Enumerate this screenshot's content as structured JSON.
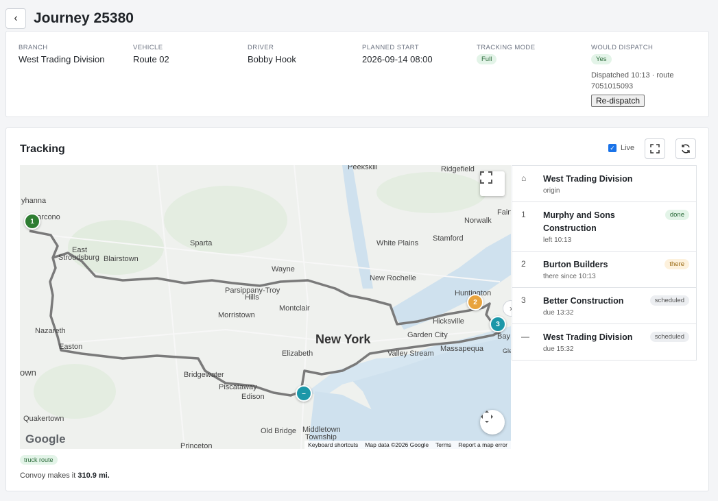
{
  "header": {
    "title": "Journey 25380"
  },
  "info": {
    "branch": {
      "label": "BRANCH",
      "value": "West Trading Division"
    },
    "vehicle": {
      "label": "VEHICLE",
      "value": "Route 02"
    },
    "driver": {
      "label": "DRIVER",
      "value": "Bobby Hook"
    },
    "planned_start": {
      "label": "PLANNED START",
      "value": "2026-09-14 08:00"
    },
    "tracking_mode": {
      "label": "TRACKING MODE",
      "value": "Full"
    },
    "would_dispatch": {
      "label": "WOULD DISPATCH",
      "value": "Yes",
      "note": "Dispatched 10:13 · route 7051015093",
      "button": "Re-dispatch"
    }
  },
  "tracking": {
    "title": "Tracking",
    "live_label": "Live",
    "live_checked": true,
    "map": {
      "places": [
        "Peekskill",
        "Ridgefield",
        "Fairf",
        "yhanna",
        "Marcono",
        "Norwalk",
        "Sparta",
        "East",
        "Stroudsburg",
        "Blairstown",
        "White Plains",
        "Stamford",
        "Wayne",
        "New Rochelle",
        "Parsippany-Troy",
        "Hills",
        "Huntington",
        "Montclair",
        "Morristown",
        "Hicksville",
        "New York",
        "Garden City",
        "Nazareth",
        "Bay",
        "Easton",
        "Elizabeth",
        "Valley Stream",
        "Massapequa",
        "own",
        "Bridgewater",
        "Piscataway",
        "Edison",
        "Quakertown",
        "Old Bridge",
        "Middletown",
        "Township",
        "Princeton",
        "Gle"
      ],
      "markers": [
        {
          "label": "1",
          "color": "#2e7d32"
        },
        {
          "label": "2",
          "color": "#e8a33d"
        },
        {
          "label": "3",
          "color": "#1c97a8"
        },
        {
          "label": "–",
          "color": "#1c97a8"
        }
      ],
      "google_logo": "Google",
      "attribution": [
        "Keyboard shortcuts",
        "Map data ©2026 Google",
        "Terms",
        "Report a map error"
      ]
    },
    "stops": [
      {
        "index": "⌂",
        "name": "West Trading Division",
        "sub": "origin",
        "badge": "",
        "badge_type": ""
      },
      {
        "index": "1",
        "name": "Murphy and Sons Construction",
        "sub": "left 10:13",
        "badge": "done",
        "badge_type": "done"
      },
      {
        "index": "2",
        "name": "Burton Builders",
        "sub": "there since 10:13",
        "badge": "there",
        "badge_type": "there"
      },
      {
        "index": "3",
        "name": "Better Construction",
        "sub": "due 13:32",
        "badge": "scheduled",
        "badge_type": "scheduled"
      },
      {
        "index": "—",
        "name": "West Trading Division",
        "sub": "due 15:32",
        "badge": "scheduled",
        "badge_type": "scheduled"
      }
    ],
    "route_badge": "truck route",
    "distance_prefix": "Convoy makes it",
    "distance_value": "310.9 mi."
  }
}
